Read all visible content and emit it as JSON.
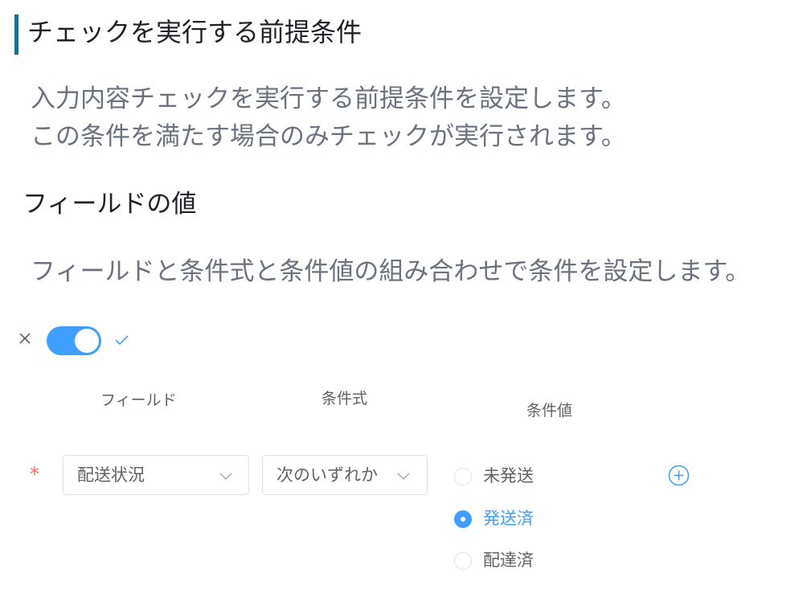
{
  "section": {
    "title": "チェックを実行する前提条件",
    "description_line1": "入力内容チェックを実行する前提条件を設定します。",
    "description_line2": "この条件を満たす場合のみチェックが実行されます。"
  },
  "field_value_section": {
    "title": "フィールドの値",
    "description": "フィールドと条件式と条件値の組み合わせで条件を設定します。"
  },
  "toggle": {
    "state": "on",
    "off_icon": "close-icon",
    "on_icon": "check-icon"
  },
  "columns": {
    "field": "フィールド",
    "operator": "条件式",
    "value": "条件値"
  },
  "condition": {
    "required_mark": "*",
    "field_select": "配送状況",
    "operator_select": "次のいずれか",
    "options": [
      {
        "label": "未発送",
        "checked": false
      },
      {
        "label": "発送済",
        "checked": true
      },
      {
        "label": "配達済",
        "checked": false
      }
    ],
    "add_icon": "plus-circle-icon"
  },
  "colors": {
    "accent": "#409eff",
    "section_bar": "#1f6f8b",
    "required": "#f56c6c",
    "muted_text": "#6b7280"
  }
}
